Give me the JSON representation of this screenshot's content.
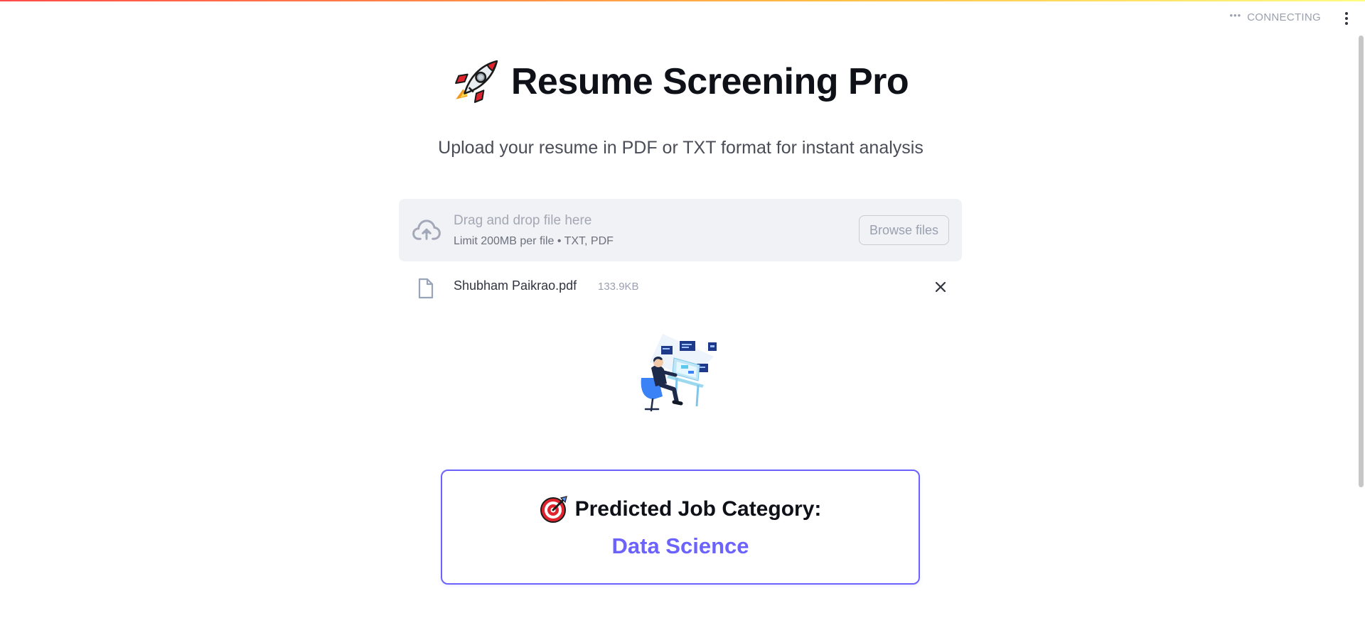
{
  "app": {
    "status": {
      "icon": "ellipsis-icon",
      "label": "CONNECTING"
    },
    "menu_icon": "vertical-dots-icon",
    "accent_color": "#6c63ff",
    "decoration_colors": [
      "#ff4b4b",
      "#ffbd45",
      "#fffd80"
    ]
  },
  "header": {
    "title_icon": "rocket-icon",
    "title": "Resume Screening Pro",
    "subtitle": "Upload your resume in PDF or TXT format for instant analysis"
  },
  "uploader": {
    "icon": "cloud-upload-icon",
    "drop_text": "Drag and drop file here",
    "limit_text": "Limit 200MB per file • TXT, PDF",
    "browse_label": "Browse files"
  },
  "uploaded_file": {
    "icon": "file-icon",
    "name": "Shubham Paikrao.pdf",
    "size": "133.9KB",
    "remove_icon": "close-icon"
  },
  "illustration": {
    "icon": "person-at-computer-illustration"
  },
  "result": {
    "icon": "target-icon",
    "heading": "Predicted Job Category:",
    "value": "Data Science"
  }
}
